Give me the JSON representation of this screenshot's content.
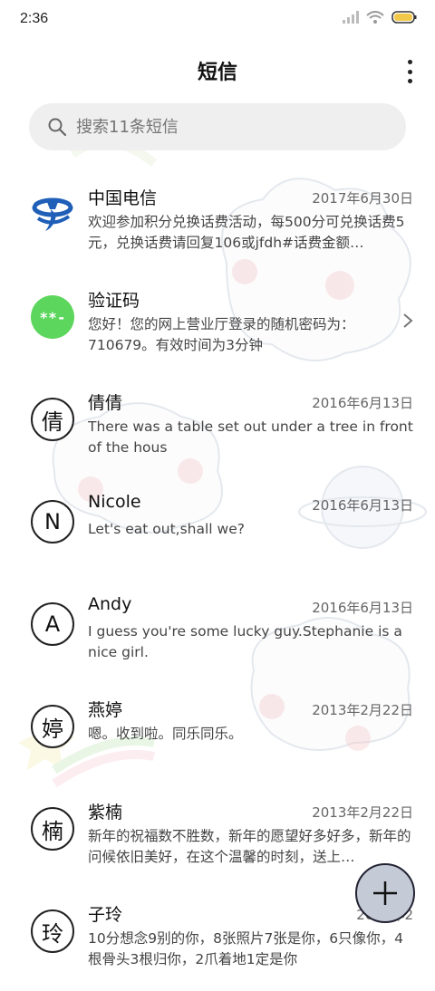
{
  "status_bar": {
    "time": "2:36"
  },
  "header": {
    "title": "短信"
  },
  "search": {
    "placeholder": "搜索11条短信"
  },
  "conversations": [
    {
      "avatar": "",
      "name": "中国电信",
      "date": "2017年6月30日",
      "preview": "欢迎参加积分兑换话费活动，每500分可兑换话费5元，兑换话费请回复106或jfdh#话费金额…"
    },
    {
      "avatar": "**-",
      "name": "验证码",
      "date": "",
      "preview": "您好！您的网上营业厅登录的随机密码为：710679。有效时间为3分钟"
    },
    {
      "avatar": "倩",
      "name": "倩倩",
      "date": "2016年6月13日",
      "preview": "There was a table set out under a tree in front of the hous"
    },
    {
      "avatar": "N",
      "name": "Nicole",
      "date": "2016年6月13日",
      "preview": "Let's eat out,shall we?"
    },
    {
      "avatar": "A",
      "name": "Andy",
      "date": "2016年6月13日",
      "preview": "I guess you're some lucky guy.Stephanie is a nice girl."
    },
    {
      "avatar": "婷",
      "name": "燕婷",
      "date": "2013年2月22日",
      "preview": "嗯。收到啦。同乐同乐。"
    },
    {
      "avatar": "楠",
      "name": "紫楠",
      "date": "2013年2月22日",
      "preview": "新年的祝福数不胜数，新年的愿望好多好多，新年的问候依旧美好，在这个温馨的时刻，送上…"
    },
    {
      "avatar": "玲",
      "name": "子玲",
      "date": "2013年2",
      "preview": "10分想念9别的你，8张照片7张是你，6只像你，4根骨头3根归你，2爪着地1定是你"
    }
  ],
  "icons": {
    "telecom_logo": "china-telecom-icon",
    "search": "search-icon",
    "more": "more-vertical-icon",
    "chevron": "chevron-right-icon",
    "fab": "plus-icon"
  },
  "colors": {
    "accent_green": "#5cd65c",
    "telecom_blue": "#1f5fb8",
    "fab_bg": "#c5cbd6"
  }
}
